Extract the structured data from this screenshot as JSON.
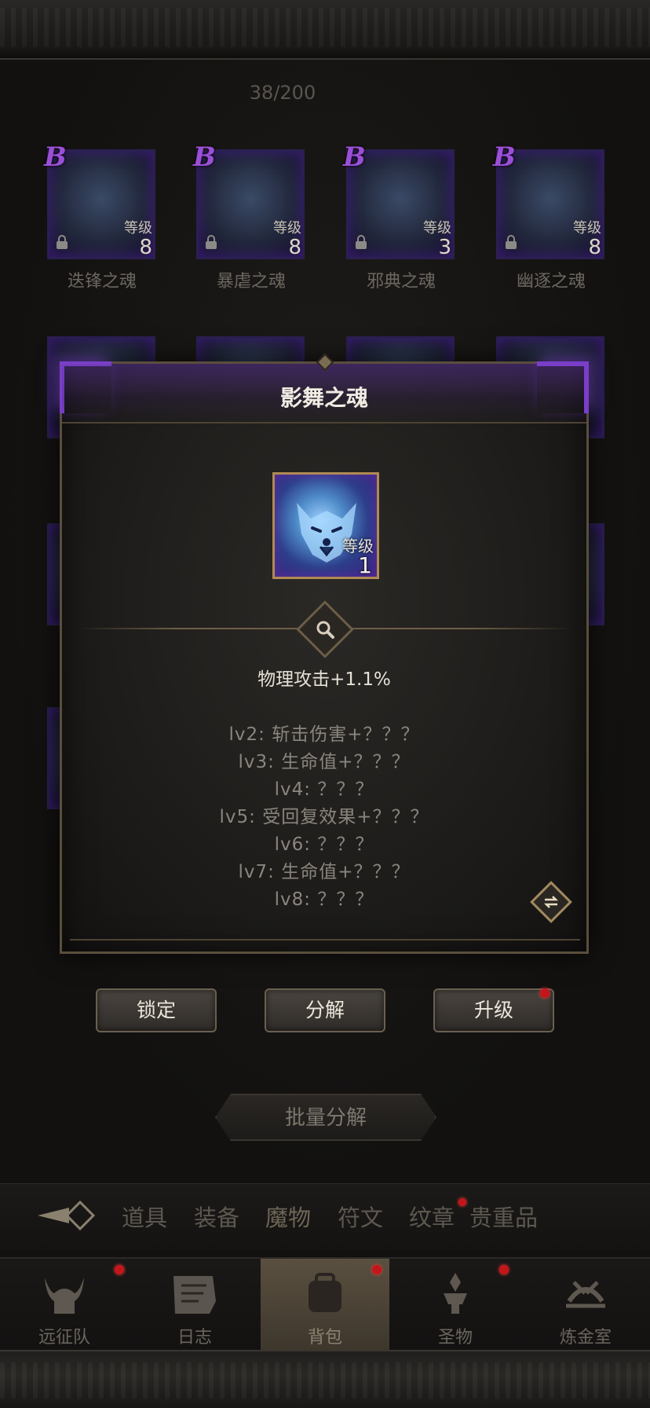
{
  "inventory": {
    "capacity": "38/200"
  },
  "grid_cards": [
    {
      "rank": "B",
      "level_label": "等级",
      "level": "8",
      "name": "迭锋之魂"
    },
    {
      "rank": "B",
      "level_label": "等级",
      "level": "8",
      "name": "暴虐之魂"
    },
    {
      "rank": "B",
      "level_label": "等级",
      "level": "3",
      "name": "邪典之魂"
    },
    {
      "rank": "B",
      "level_label": "等级",
      "level": "8",
      "name": "幽逐之魂"
    }
  ],
  "dialog": {
    "title": "影舞之魂",
    "item": {
      "level_label": "等级",
      "level": "1",
      "icon": "wolf-icon"
    },
    "main_attr": "物理攻击+1.1%",
    "levels": [
      "lv2: 斩击伤害+？？？",
      "lv3: 生命值+？？？",
      "lv4: ？？？",
      "lv5: 受回复效果+？？？",
      "lv6: ？？？",
      "lv7: 生命值+？？？",
      "lv8: ？？？"
    ]
  },
  "actions": {
    "lock": "锁定",
    "decompose": "分解",
    "upgrade": "升级"
  },
  "batch_decompose": "批量分解",
  "tabs": [
    "道具",
    "装备",
    "魔物",
    "符文",
    "纹章",
    "贵重品"
  ],
  "nav": [
    {
      "label": "远征队",
      "icon": "viking-helmet-icon"
    },
    {
      "label": "日志",
      "icon": "scroll-icon"
    },
    {
      "label": "背包",
      "icon": "backpack-icon"
    },
    {
      "label": "圣物",
      "icon": "relic-icon"
    },
    {
      "label": "炼金室",
      "icon": "alchemy-icon"
    }
  ],
  "colors": {
    "rank_purple": "#9b4fd6",
    "frame_purple": "#7b3ec9",
    "gold": "#b08a52",
    "notify_red": "#c4161a"
  }
}
